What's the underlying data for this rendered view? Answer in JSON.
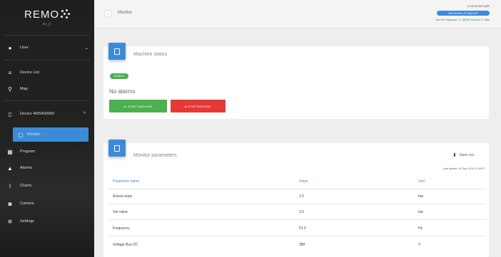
{
  "app": {
    "logo": "REMO",
    "logo_sub": "PLC"
  },
  "sidebar": {
    "user": "User",
    "items": [
      {
        "label": "Device List"
      },
      {
        "label": "Map"
      }
    ],
    "device": "Device 4MS400066",
    "sub_items": [
      {
        "label": "Monitor"
      },
      {
        "label": "Program"
      },
      {
        "label": "Alarms"
      },
      {
        "label": "Charts"
      },
      {
        "label": "Camera"
      },
      {
        "label": "Settings"
      }
    ]
  },
  "header": {
    "title": "Monitor",
    "connected_label": "Connected with",
    "connection_id": "4MS400066-ETHBOX8F",
    "location": "Via del Progresso, X, 36020 Vicenza VI, Italy"
  },
  "machine_status": {
    "title": "Machine status",
    "status_badge": "ARRESO",
    "alarms_text": "No alarms",
    "start_button": "► START MACHINE",
    "stop_button": "■ STOP MACHINE"
  },
  "monitor_params": {
    "title": "Monitor parameters",
    "save_csv": "Save csv",
    "last_update": "Last update: 03 Sep 2019 10:48:27",
    "columns": [
      "Parameter name",
      "Value",
      "Unit"
    ],
    "rows": [
      {
        "name": "Actual value",
        "value": "1.5",
        "unit": "bar"
      },
      {
        "name": "Set value",
        "value": "3.0",
        "unit": "bar"
      },
      {
        "name": "Frequency",
        "value": "51.0",
        "unit": "Hz"
      },
      {
        "name": "Voltage Bus DC",
        "value": "389",
        "unit": "V"
      }
    ]
  },
  "colors": {
    "accent": "#3c8bd9",
    "success": "#4caf50",
    "danger": "#e53935",
    "sidebar": "#222222"
  }
}
